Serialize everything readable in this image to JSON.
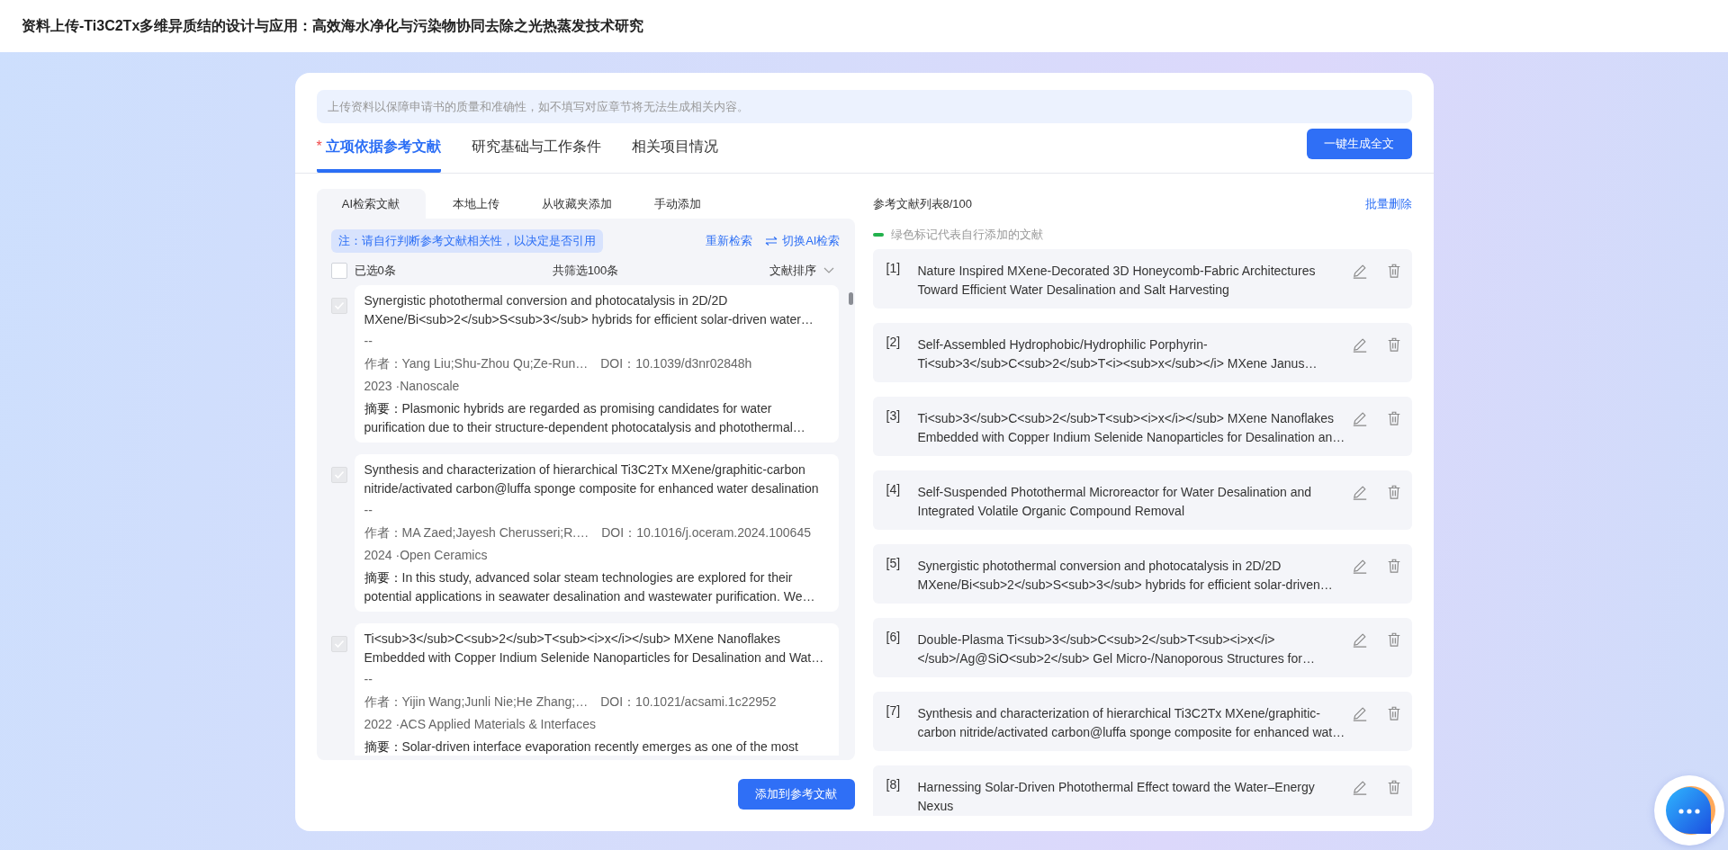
{
  "page_title": "资料上传-Ti3C2Tx多维异质结的设计与应用：高效海水净化与污染物协同去除之光热蒸发技术研究",
  "notice": "上传资料以保障申请书的质量和准确性，如不填写对应章节将无法生成相关内容。",
  "tabs": [
    {
      "label": "立项依据参考文献",
      "required_mark": "*",
      "selected": true
    },
    {
      "label": "研究基础与工作条件",
      "selected": false
    },
    {
      "label": "相关项目情况",
      "selected": false
    }
  ],
  "generate_button": "一键生成全文",
  "source_tabs": [
    {
      "label": "AI检索文献",
      "selected": true
    },
    {
      "label": "本地上传",
      "selected": false
    },
    {
      "label": "从收藏夹添加",
      "selected": false
    },
    {
      "label": "手动添加",
      "selected": false
    }
  ],
  "note": "注：请自行判断参考文献相关性，以决定是否引用",
  "retrieve_link": "重新检索",
  "switch_link": "切换AI检索",
  "select_all": {
    "label": "已选0条",
    "checked": false
  },
  "total": "共筛选100条",
  "sort": "文献排序",
  "results": [
    {
      "checked": true,
      "disabled": true,
      "title": "Synergistic photothermal conversion and photocatalysis in 2D/2D MXene/Bi<sub>2</sub>S<sub>3</sub> hybrids for efficient solar-driven water…",
      "dash": "--",
      "authors": "作者：Yang Liu;Shu-Zhou Qu;Ze-Run…",
      "doi": "DOI：10.1039/d3nr02848h",
      "source": "2023 ·Nanoscale",
      "abstract": "**摘要：**Plasmonic hybrids are regarded as promising candidates for water purification due to their structure-dependent photocatalysis and photothermal…"
    },
    {
      "checked": true,
      "disabled": true,
      "title": "Synthesis and characterization of hierarchical Ti3C2Tx MXene/graphitic-carbon nitride/activated carbon@luffa sponge composite for enhanced water desalination",
      "dash": "--",
      "authors": "作者：MA Zaed;Jayesh Cherusseri;R.…",
      "doi": "DOI：10.1016/j.oceram.2024.100645",
      "source": "2024 ·Open Ceramics",
      "abstract": "**摘要：**In this study, advanced solar steam technologies are explored for their potential applications in seawater desalination and wastewater purification. We…"
    },
    {
      "checked": true,
      "disabled": true,
      "title": "Ti<sub>3</sub>C<sub>2</sub>T<sub><i>x</i></sub> MXene Nanoflakes Embedded with Copper Indium Selenide Nanoparticles for Desalination and Wat…",
      "dash": "--",
      "authors": "作者：Yijin Wang;Junli Nie;He Zhang;…",
      "doi": "DOI：10.1021/acsami.1c22952",
      "source": "2022 ·ACS Applied Materials & Interfaces",
      "abstract": "**摘要：**Solar-driven interface evaporation recently emerges as one of the most"
    }
  ],
  "add_button": "添加到参考文献",
  "references_header": "参考文献列表8/100",
  "batch_delete": "批量删除",
  "legend": "绿色标记代表自行添加的文献",
  "references": [
    {
      "number": "[1]",
      "title": "Nature Inspired MXene-Decorated 3D Honeycomb-Fabric Architectures Toward Efficient Water Desalination and Salt Harvesting"
    },
    {
      "number": "[2]",
      "title": "Self-Assembled Hydrophobic/Hydrophilic Porphyrin-Ti<sub>3</sub>C<sub>2</sub>T<i><sub>x</sub></i> MXene Janus…"
    },
    {
      "number": "[3]",
      "title": "Ti<sub>3</sub>C<sub>2</sub>T<sub><i>x</i></sub> MXene Nanoflakes Embedded with Copper Indium Selenide Nanoparticles for Desalination an…"
    },
    {
      "number": "[4]",
      "title": "Self-Suspended Photothermal Microreactor for Water Desalination and Integrated Volatile Organic Compound Removal"
    },
    {
      "number": "[5]",
      "title": "Synergistic photothermal conversion and photocatalysis in 2D/2D MXene/Bi<sub>2</sub>S<sub>3</sub> hybrids for efficient solar-driven…"
    },
    {
      "number": "[6]",
      "title": "Double-Plasma Ti<sub>3</sub>C<sub>2</sub>T<sub><i>x</i> </sub>/Ag@SiO<sub>2</sub> Gel Micro-/Nanoporous Structures for…"
    },
    {
      "number": "[7]",
      "title": "Synthesis and characterization of hierarchical Ti3C2Tx MXene/graphitic-carbon nitride/activated carbon@luffa sponge composite for enhanced wat…"
    },
    {
      "number": "[8]",
      "title": "Harnessing Solar-Driven Photothermal Effect toward the Water–Energy Nexus"
    }
  ]
}
